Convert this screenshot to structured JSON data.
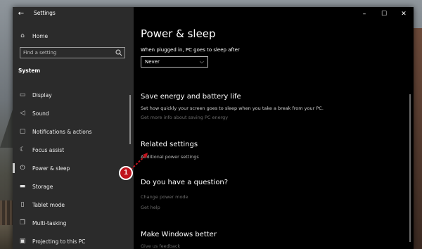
{
  "app_title": "Settings",
  "window_controls": {
    "minimize": "–",
    "maximize": "☐",
    "close": "✕"
  },
  "sidebar": {
    "home_label": "Home",
    "search_placeholder": "Find a setting",
    "section_title": "System",
    "items": [
      {
        "label": "Display",
        "icon": "monitor-icon",
        "glyph": "▭"
      },
      {
        "label": "Sound",
        "icon": "speaker-icon",
        "glyph": "◁"
      },
      {
        "label": "Notifications & actions",
        "icon": "notification-icon",
        "glyph": "▢"
      },
      {
        "label": "Focus assist",
        "icon": "moon-icon",
        "glyph": "☾"
      },
      {
        "label": "Power & sleep",
        "icon": "power-icon",
        "glyph": "⏻",
        "selected": true
      },
      {
        "label": "Storage",
        "icon": "storage-icon",
        "glyph": "▬"
      },
      {
        "label": "Tablet mode",
        "icon": "tablet-icon",
        "glyph": "▯"
      },
      {
        "label": "Multi-tasking",
        "icon": "multitask-icon",
        "glyph": "❐"
      },
      {
        "label": "Projecting to this PC",
        "icon": "project-icon",
        "glyph": "▣"
      }
    ]
  },
  "main": {
    "title": "Power & sleep",
    "plugged_label": "When plugged in, PC goes to sleep after",
    "sleep_value": "Never",
    "save_energy": {
      "heading": "Save energy and battery life",
      "description": "Set how quickly your screen goes to sleep when you take a break from your PC.",
      "link": "Get more info about saving PC energy"
    },
    "related": {
      "heading": "Related settings",
      "link": "Additional power settings"
    },
    "question": {
      "heading": "Do you have a question?",
      "links": [
        "Change power mode",
        "Get help"
      ]
    },
    "better": {
      "heading": "Make Windows better",
      "link": "Give us feedback"
    }
  },
  "annotation": {
    "badge": "1",
    "color": "#c0131c"
  }
}
